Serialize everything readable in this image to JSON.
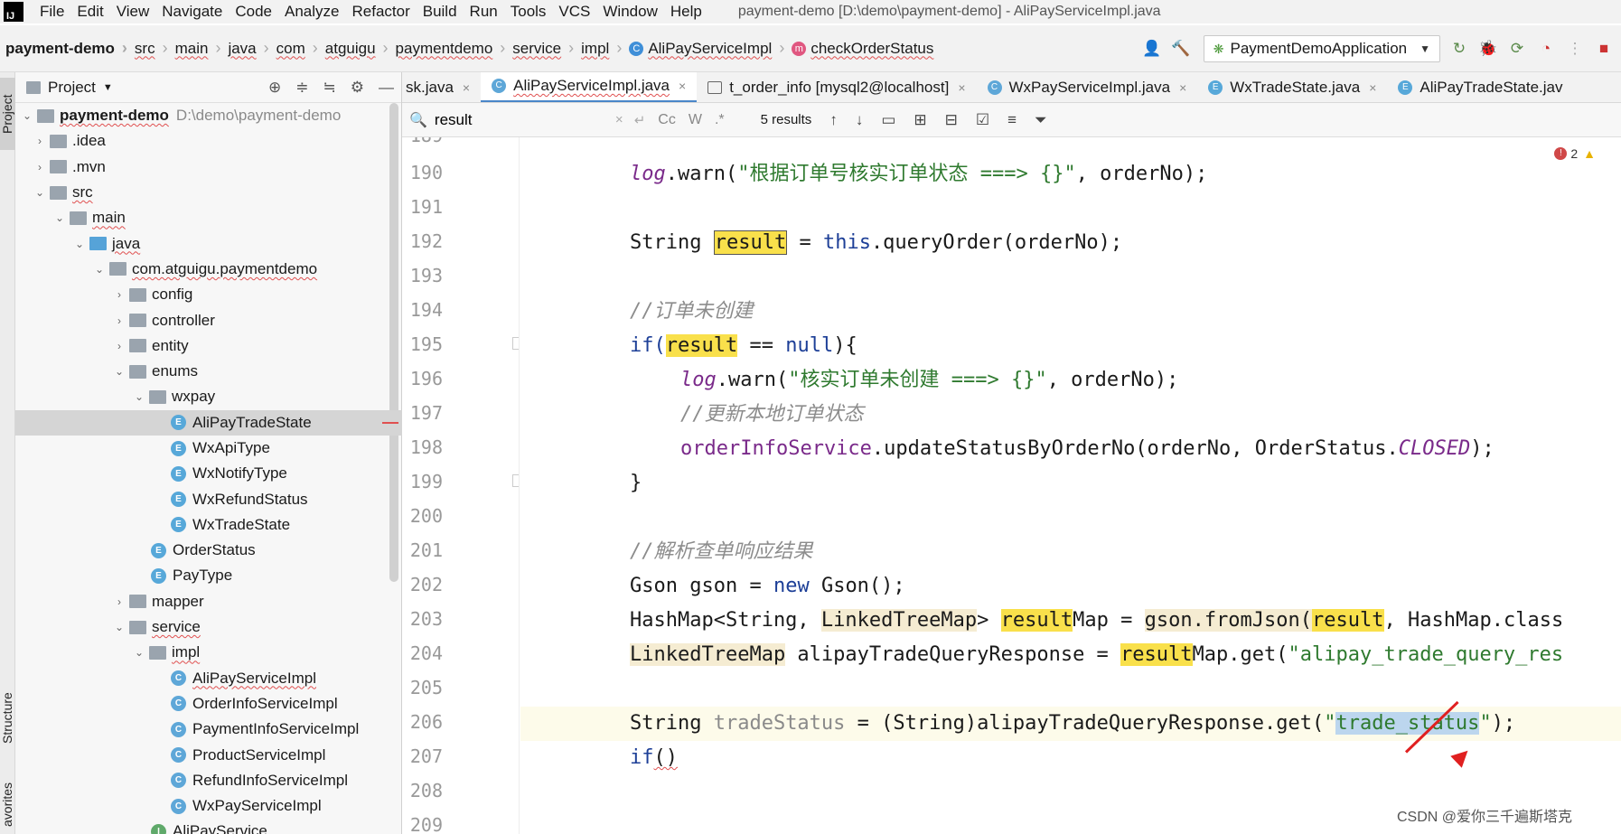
{
  "menu": {
    "items": [
      "File",
      "Edit",
      "View",
      "Navigate",
      "Code",
      "Analyze",
      "Refactor",
      "Build",
      "Run",
      "Tools",
      "VCS",
      "Window",
      "Help"
    ],
    "window_title": "payment-demo [D:\\demo\\payment-demo] - AliPayServiceImpl.java"
  },
  "breadcrumb": {
    "project": "payment-demo",
    "parts": [
      "src",
      "main",
      "java",
      "com",
      "atguigu",
      "paymentdemo",
      "service",
      "impl"
    ],
    "class": "AliPayServiceImpl",
    "method": "checkOrderStatus"
  },
  "toolbar": {
    "run_config": "PaymentDemoApplication"
  },
  "left_strip": {
    "project_tab": "Project",
    "structure_tab": "Structure",
    "favorites_tab": "avorites"
  },
  "project_panel": {
    "title": "Project",
    "root": {
      "name": "payment-demo",
      "path": "D:\\demo\\payment-demo"
    },
    "items": [
      ".idea",
      ".mvn",
      "src",
      "main",
      "java",
      "com.atguigu.paymentdemo",
      "config",
      "controller",
      "entity",
      "enums",
      "wxpay",
      "AliPayTradeState",
      "WxApiType",
      "WxNotifyType",
      "WxRefundStatus",
      "WxTradeState",
      "OrderStatus",
      "PayType",
      "mapper",
      "service",
      "impl",
      "AliPayServiceImpl",
      "OrderInfoServiceImpl",
      "PaymentInfoServiceImpl",
      "ProductServiceImpl",
      "RefundInfoServiceImpl",
      "WxPayServiceImpl",
      "AliPayService"
    ]
  },
  "tabs": [
    "sk.java",
    "AliPayServiceImpl.java",
    "t_order_info [mysql2@localhost]",
    "WxPayServiceImpl.java",
    "WxTradeState.java",
    "AliPayTradeState.jav"
  ],
  "search": {
    "query": "result",
    "count": "5 results",
    "case_label": "Cc",
    "word_label": "W",
    "regex_label": ".*"
  },
  "editor": {
    "line_numbers": [
      "189",
      "190",
      "191",
      "192",
      "193",
      "194",
      "195",
      "196",
      "197",
      "198",
      "199",
      "200",
      "201",
      "202",
      "203",
      "204",
      "205",
      "206",
      "207",
      "208",
      "209"
    ],
    "error_count": "2",
    "lines": {
      "l190": {
        "a": "log",
        "b": ".warn(",
        "c": "\"根据订单号核实订单状态 ===> {}\"",
        "d": ", orderNo);"
      },
      "l192": {
        "a": "String ",
        "b": "result",
        "c": " = ",
        "d": "this",
        "e": ".queryOrder(orderNo);"
      },
      "l194": {
        "a": "//订单未创建"
      },
      "l195": {
        "a": "if(",
        "b": "result",
        "c": " == ",
        "d": "null",
        "e": "){"
      },
      "l196": {
        "a": "log",
        "b": ".warn(",
        "c": "\"核实订单未创建 ===> {}\"",
        "d": ", orderNo);"
      },
      "l197": {
        "a": "//更新本地订单状态"
      },
      "l198": {
        "a": "orderInfoService",
        "b": ".updateStatusByOrderNo(orderNo, OrderStatus.",
        "c": "CLOSED",
        "d": ");"
      },
      "l199": {
        "a": "}"
      },
      "l201": {
        "a": "//解析查单响应结果"
      },
      "l202": {
        "a": "Gson gson = ",
        "b": "new",
        "c": " Gson();"
      },
      "l203": {
        "a": "HashMap<String, ",
        "b": "LinkedTreeMap",
        "c": "> ",
        "d": "result",
        "e": "Map",
        "f": " = ",
        "g": "gson.fromJson(",
        "h": "result",
        "i": ", HashMap.class"
      },
      "l204": {
        "a": "LinkedTreeMap",
        "b": " alipayTradeQueryResponse = ",
        "c": "result",
        "d": "Map.get(",
        "e": "\"alipay_trade_query_res"
      },
      "l206": {
        "a": "String ",
        "b": "tradeStatus",
        "c": " = (String)alipayTradeQueryResponse.get(",
        "d": "\"",
        "e": "trade_status",
        "f": "\"",
        "g": ");"
      },
      "l207": {
        "a": "if",
        "b": "()"
      }
    }
  },
  "watermark": "CSDN @爱你三千遍斯塔克",
  "colors": {
    "accent": "#4a86c8",
    "search_match": "#f9e04b",
    "selection": "#bcd6ee",
    "annotation_arrow": "#e02020"
  }
}
